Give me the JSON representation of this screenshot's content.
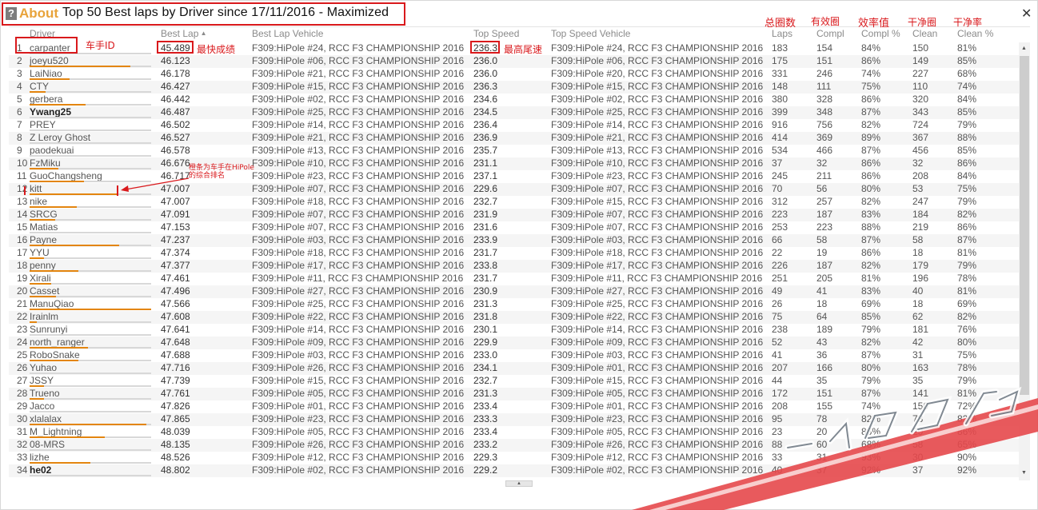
{
  "title": {
    "about": "About",
    "text": "Top 50 Best laps by Driver since 17/11/2016 - Maximized"
  },
  "icons": {
    "help": "question-mark-icon",
    "close": "close-icon"
  },
  "colors": {
    "accent": "#e8a33a",
    "bar": "#e3850f",
    "annotation": "#d9191c"
  },
  "columns": {
    "driver": "Driver",
    "best_lap": "Best Lap",
    "best_lap_vehicle": "Best Lap Vehicle",
    "top_speed": "Top Speed",
    "top_speed_vehicle": "Top Speed Vehicle",
    "laps": "Laps",
    "compl": "Compl",
    "compl_pct": "Compl %",
    "clean": "Clean",
    "clean_pct": "Clean %"
  },
  "annotations": {
    "driver_id": "车手ID",
    "best_lap": "最快成绩",
    "top_speed": "最高尾速",
    "total_laps": "总圈数",
    "valid_laps": "有效圈",
    "efficiency": "效率值",
    "clean_laps": "干净圈",
    "clean_rate": "干净率",
    "bar_note": "橙条为车手在HiPole的综合排名"
  },
  "rows": [
    {
      "rank": "1",
      "driver": "carpanter",
      "bar": 0,
      "best": "45.489",
      "bestveh": "F309:HiPole #24, RCC F3 CHAMPIONSHIP 2016",
      "top": "236.3",
      "topveh": "F309:HiPole #24, RCC F3 CHAMPIONSHIP 2016",
      "laps": "183",
      "compl": "154",
      "pct": "84%",
      "clean": "150",
      "cleanpct": "81%"
    },
    {
      "rank": "2",
      "driver": "joeyu520",
      "bar": 0.83,
      "best": "46.123",
      "bestveh": "F309:HiPole #06, RCC F3 CHAMPIONSHIP 2016",
      "top": "236.0",
      "topveh": "F309:HiPole #06, RCC F3 CHAMPIONSHIP 2016",
      "laps": "175",
      "compl": "151",
      "pct": "86%",
      "clean": "149",
      "cleanpct": "85%"
    },
    {
      "rank": "3",
      "driver": "LaiNiao",
      "bar": 0.33,
      "best": "46.178",
      "bestveh": "F309:HiPole #21, RCC F3 CHAMPIONSHIP 2016",
      "top": "236.0",
      "topveh": "F309:HiPole #20, RCC F3 CHAMPIONSHIP 2016",
      "laps": "331",
      "compl": "246",
      "pct": "74%",
      "clean": "227",
      "cleanpct": "68%"
    },
    {
      "rank": "4",
      "driver": "CTY",
      "bar": 0.13,
      "best": "46.427",
      "bestveh": "F309:HiPole #15, RCC F3 CHAMPIONSHIP 2016",
      "top": "236.3",
      "topveh": "F309:HiPole #15, RCC F3 CHAMPIONSHIP 2016",
      "laps": "148",
      "compl": "111",
      "pct": "75%",
      "clean": "110",
      "cleanpct": "74%"
    },
    {
      "rank": "5",
      "driver": "gerbera",
      "bar": 0.46,
      "best": "46.442",
      "bestveh": "F309:HiPole #02, RCC F3 CHAMPIONSHIP 2016",
      "top": "234.6",
      "topveh": "F309:HiPole #02, RCC F3 CHAMPIONSHIP 2016",
      "laps": "380",
      "compl": "328",
      "pct": "86%",
      "clean": "320",
      "cleanpct": "84%"
    },
    {
      "rank": "6",
      "driver": "Ywang25",
      "bar": 0,
      "bold": true,
      "best": "46.487",
      "bestveh": "F309:HiPole #25, RCC F3 CHAMPIONSHIP 2016",
      "top": "234.5",
      "topveh": "F309:HiPole #25, RCC F3 CHAMPIONSHIP 2016",
      "laps": "399",
      "compl": "348",
      "pct": "87%",
      "clean": "343",
      "cleanpct": "85%"
    },
    {
      "rank": "7",
      "driver": "PREY",
      "bar": 0,
      "best": "46.502",
      "bestveh": "F309:HiPole #14, RCC F3 CHAMPIONSHIP 2016",
      "top": "236.4",
      "topveh": "F309:HiPole #14, RCC F3 CHAMPIONSHIP 2016",
      "laps": "916",
      "compl": "756",
      "pct": "82%",
      "clean": "724",
      "cleanpct": "79%"
    },
    {
      "rank": "8",
      "driver": "Z Leroy Ghost",
      "bar": 0,
      "best": "46.527",
      "bestveh": "F309:HiPole #21, RCC F3 CHAMPIONSHIP 2016",
      "top": "236.9",
      "topveh": "F309:HiPole #21, RCC F3 CHAMPIONSHIP 2016",
      "laps": "414",
      "compl": "369",
      "pct": "89%",
      "clean": "367",
      "cleanpct": "88%"
    },
    {
      "rank": "9",
      "driver": "paodekuai",
      "bar": 0,
      "best": "46.578",
      "bestveh": "F309:HiPole #13, RCC F3 CHAMPIONSHIP 2016",
      "top": "235.7",
      "topveh": "F309:HiPole #13, RCC F3 CHAMPIONSHIP 2016",
      "laps": "534",
      "compl": "466",
      "pct": "87%",
      "clean": "456",
      "cleanpct": "85%"
    },
    {
      "rank": "10",
      "driver": "FzMiku",
      "bar": 0.24,
      "best": "46.676",
      "bestveh": "F309:HiPole #10, RCC F3 CHAMPIONSHIP 2016",
      "top": "231.1",
      "topveh": "F309:HiPole #10, RCC F3 CHAMPIONSHIP 2016",
      "laps": "37",
      "compl": "32",
      "pct": "86%",
      "clean": "32",
      "cleanpct": "86%"
    },
    {
      "rank": "11",
      "driver": "GuoChangsheng",
      "bar": 0.45,
      "best": "46.717",
      "bestveh": "F309:HiPole #23, RCC F3 CHAMPIONSHIP 2016",
      "top": "237.1",
      "topveh": "F309:HiPole #23, RCC F3 CHAMPIONSHIP 2016",
      "laps": "245",
      "compl": "211",
      "pct": "86%",
      "clean": "208",
      "cleanpct": "84%"
    },
    {
      "rank": "12",
      "driver": "kitt",
      "bar": 0.72,
      "best": "47.007",
      "bestveh": "F309:HiPole #07, RCC F3 CHAMPIONSHIP 2016",
      "top": "229.6",
      "topveh": "F309:HiPole #07, RCC F3 CHAMPIONSHIP 2016",
      "laps": "70",
      "compl": "56",
      "pct": "80%",
      "clean": "53",
      "cleanpct": "75%"
    },
    {
      "rank": "13",
      "driver": "nike",
      "bar": 0.39,
      "best": "47.007",
      "bestveh": "F309:HiPole #18, RCC F3 CHAMPIONSHIP 2016",
      "top": "232.7",
      "topveh": "F309:HiPole #15, RCC F3 CHAMPIONSHIP 2016",
      "laps": "312",
      "compl": "257",
      "pct": "82%",
      "clean": "247",
      "cleanpct": "79%"
    },
    {
      "rank": "14",
      "driver": "SRCG",
      "bar": 0.21,
      "best": "47.091",
      "bestveh": "F309:HiPole #07, RCC F3 CHAMPIONSHIP 2016",
      "top": "231.9",
      "topveh": "F309:HiPole #07, RCC F3 CHAMPIONSHIP 2016",
      "laps": "223",
      "compl": "187",
      "pct": "83%",
      "clean": "184",
      "cleanpct": "82%"
    },
    {
      "rank": "15",
      "driver": "Matias",
      "bar": 0,
      "best": "47.153",
      "bestveh": "F309:HiPole #07, RCC F3 CHAMPIONSHIP 2016",
      "top": "231.6",
      "topveh": "F309:HiPole #07, RCC F3 CHAMPIONSHIP 2016",
      "laps": "253",
      "compl": "223",
      "pct": "88%",
      "clean": "219",
      "cleanpct": "86%"
    },
    {
      "rank": "16",
      "driver": "Payne",
      "bar": 0.74,
      "best": "47.237",
      "bestveh": "F309:HiPole #03, RCC F3 CHAMPIONSHIP 2016",
      "top": "233.9",
      "topveh": "F309:HiPole #03, RCC F3 CHAMPIONSHIP 2016",
      "laps": "66",
      "compl": "58",
      "pct": "87%",
      "clean": "58",
      "cleanpct": "87%"
    },
    {
      "rank": "17",
      "driver": "YYU",
      "bar": 0.12,
      "best": "47.374",
      "bestveh": "F309:HiPole #18, RCC F3 CHAMPIONSHIP 2016",
      "top": "231.7",
      "topveh": "F309:HiPole #18, RCC F3 CHAMPIONSHIP 2016",
      "laps": "22",
      "compl": "19",
      "pct": "86%",
      "clean": "18",
      "cleanpct": "81%"
    },
    {
      "rank": "18",
      "driver": "penny",
      "bar": 0.4,
      "best": "47.377",
      "bestveh": "F309:HiPole #17, RCC F3 CHAMPIONSHIP 2016",
      "top": "233.8",
      "topveh": "F309:HiPole #17, RCC F3 CHAMPIONSHIP 2016",
      "laps": "226",
      "compl": "187",
      "pct": "82%",
      "clean": "179",
      "cleanpct": "79%"
    },
    {
      "rank": "19",
      "driver": "Xirali",
      "bar": 0.18,
      "best": "47.461",
      "bestveh": "F309:HiPole #11, RCC F3 CHAMPIONSHIP 2016",
      "top": "231.7",
      "topveh": "F309:HiPole #11, RCC F3 CHAMPIONSHIP 2016",
      "laps": "251",
      "compl": "205",
      "pct": "81%",
      "clean": "196",
      "cleanpct": "78%"
    },
    {
      "rank": "20",
      "driver": "Casset",
      "bar": 0.22,
      "best": "47.496",
      "bestveh": "F309:HiPole #27, RCC F3 CHAMPIONSHIP 2016",
      "top": "230.9",
      "topveh": "F309:HiPole #27, RCC F3 CHAMPIONSHIP 2016",
      "laps": "49",
      "compl": "41",
      "pct": "83%",
      "clean": "40",
      "cleanpct": "81%"
    },
    {
      "rank": "21",
      "driver": "ManuQiao",
      "bar": 1.0,
      "best": "47.566",
      "bestveh": "F309:HiPole #25, RCC F3 CHAMPIONSHIP 2016",
      "top": "231.3",
      "topveh": "F309:HiPole #25, RCC F3 CHAMPIONSHIP 2016",
      "laps": "26",
      "compl": "18",
      "pct": "69%",
      "clean": "18",
      "cleanpct": "69%"
    },
    {
      "rank": "22",
      "driver": "Irainlm",
      "bar": 0.06,
      "best": "47.608",
      "bestveh": "F309:HiPole #22, RCC F3 CHAMPIONSHIP 2016",
      "top": "231.8",
      "topveh": "F309:HiPole #22, RCC F3 CHAMPIONSHIP 2016",
      "laps": "75",
      "compl": "64",
      "pct": "85%",
      "clean": "62",
      "cleanpct": "82%"
    },
    {
      "rank": "23",
      "driver": "Sunrunyi",
      "bar": 0,
      "best": "47.641",
      "bestveh": "F309:HiPole #14, RCC F3 CHAMPIONSHIP 2016",
      "top": "230.1",
      "topveh": "F309:HiPole #14, RCC F3 CHAMPIONSHIP 2016",
      "laps": "238",
      "compl": "189",
      "pct": "79%",
      "clean": "181",
      "cleanpct": "76%"
    },
    {
      "rank": "24",
      "driver": "north_ranger",
      "bar": 0.48,
      "best": "47.648",
      "bestveh": "F309:HiPole #09, RCC F3 CHAMPIONSHIP 2016",
      "top": "229.9",
      "topveh": "F309:HiPole #09, RCC F3 CHAMPIONSHIP 2016",
      "laps": "52",
      "compl": "43",
      "pct": "82%",
      "clean": "42",
      "cleanpct": "80%"
    },
    {
      "rank": "25",
      "driver": "RoboSnake",
      "bar": 0.4,
      "best": "47.688",
      "bestveh": "F309:HiPole #03, RCC F3 CHAMPIONSHIP 2016",
      "top": "233.0",
      "topveh": "F309:HiPole #03, RCC F3 CHAMPIONSHIP 2016",
      "laps": "41",
      "compl": "36",
      "pct": "87%",
      "clean": "31",
      "cleanpct": "75%"
    },
    {
      "rank": "26",
      "driver": "Yuhao",
      "bar": 0,
      "best": "47.716",
      "bestveh": "F309:HiPole #26, RCC F3 CHAMPIONSHIP 2016",
      "top": "234.1",
      "topveh": "F309:HiPole #01, RCC F3 CHAMPIONSHIP 2016",
      "laps": "207",
      "compl": "166",
      "pct": "80%",
      "clean": "163",
      "cleanpct": "78%"
    },
    {
      "rank": "27",
      "driver": "JSSY",
      "bar": 0.12,
      "best": "47.739",
      "bestveh": "F309:HiPole #15, RCC F3 CHAMPIONSHIP 2016",
      "top": "232.7",
      "topveh": "F309:HiPole #15, RCC F3 CHAMPIONSHIP 2016",
      "laps": "44",
      "compl": "35",
      "pct": "79%",
      "clean": "35",
      "cleanpct": "79%"
    },
    {
      "rank": "28",
      "driver": "Trueno",
      "bar": 0.12,
      "best": "47.761",
      "bestveh": "F309:HiPole #05, RCC F3 CHAMPIONSHIP 2016",
      "top": "231.3",
      "topveh": "F309:HiPole #05, RCC F3 CHAMPIONSHIP 2016",
      "laps": "172",
      "compl": "151",
      "pct": "87%",
      "clean": "141",
      "cleanpct": "81%"
    },
    {
      "rank": "29",
      "driver": "Jacco",
      "bar": 0,
      "best": "47.826",
      "bestveh": "F309:HiPole #01, RCC F3 CHAMPIONSHIP 2016",
      "top": "233.4",
      "topveh": "F309:HiPole #01, RCC F3 CHAMPIONSHIP 2016",
      "laps": "208",
      "compl": "155",
      "pct": "74%",
      "clean": "150",
      "cleanpct": "72%"
    },
    {
      "rank": "30",
      "driver": "xlalalax",
      "bar": 0.96,
      "best": "47.865",
      "bestveh": "F309:HiPole #23, RCC F3 CHAMPIONSHIP 2016",
      "top": "233.3",
      "topveh": "F309:HiPole #23, RCC F3 CHAMPIONSHIP 2016",
      "laps": "95",
      "compl": "78",
      "pct": "82%",
      "clean": "78",
      "cleanpct": "82%"
    },
    {
      "rank": "31",
      "driver": "M_Lightning",
      "bar": 0.62,
      "best": "48.039",
      "bestveh": "F309:HiPole #05, RCC F3 CHAMPIONSHIP 2016",
      "top": "233.4",
      "topveh": "F309:HiPole #05, RCC F3 CHAMPIONSHIP 2016",
      "laps": "23",
      "compl": "20",
      "pct": "86%",
      "clean": "20",
      "cleanpct": "86%"
    },
    {
      "rank": "32",
      "driver": "08-MRS",
      "bar": 0,
      "best": "48.135",
      "bestveh": "F309:HiPole #26, RCC F3 CHAMPIONSHIP 2016",
      "top": "233.2",
      "topveh": "F309:HiPole #26, RCC F3 CHAMPIONSHIP 2016",
      "laps": "88",
      "compl": "60",
      "pct": "68%",
      "clean": "58",
      "cleanpct": "65%"
    },
    {
      "rank": "33",
      "driver": "lizhe",
      "bar": 0.5,
      "best": "48.526",
      "bestveh": "F309:HiPole #12, RCC F3 CHAMPIONSHIP 2016",
      "top": "229.3",
      "topveh": "F309:HiPole #12, RCC F3 CHAMPIONSHIP 2016",
      "laps": "33",
      "compl": "31",
      "pct": "93%",
      "clean": "30",
      "cleanpct": "90%"
    },
    {
      "rank": "34",
      "driver": "he02",
      "bar": 0,
      "bold": true,
      "best": "48.802",
      "bestveh": "F309:HiPole #02, RCC F3 CHAMPIONSHIP 2016",
      "top": "229.2",
      "topveh": "F309:HiPole #02, RCC F3 CHAMPIONSHIP 2016",
      "laps": "40",
      "compl": "37",
      "pct": "92%",
      "clean": "37",
      "cleanpct": "92%"
    }
  ]
}
